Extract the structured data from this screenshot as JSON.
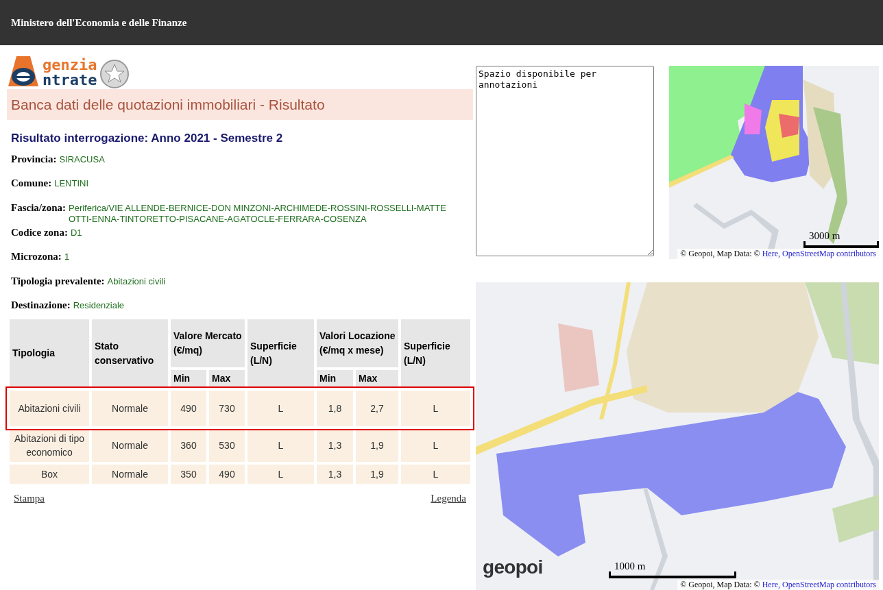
{
  "header": {
    "title": "Ministero dell'Economia e delle Finanze"
  },
  "logo": {
    "line_1": "genzia",
    "line_2": "ntrate"
  },
  "page_title": "Banca dati delle quotazioni immobiliari - Risultato",
  "result_heading": "Risultato interrogazione: Anno 2021 - Semestre 2",
  "fields": [
    {
      "label": "Provincia:",
      "value": "SIRACUSA"
    },
    {
      "label": "Comune:",
      "value": "LENTINI"
    },
    {
      "label": "Fascia/zona:",
      "value": "Periferica/VIE ALLENDE-BERNICE-DON MINZONI-ARCHIMEDE-ROSSINI-ROSSELLI-MATTEOTTI-ENNA-TINTORETTO-PISACANE-AGATOCLE-FERRARA-COSENZA"
    },
    {
      "label": "Codice zona:",
      "value": "D1"
    },
    {
      "label": "Microzona:",
      "value": "1"
    },
    {
      "label": "Tipologia prevalente:",
      "value": "Abitazioni civili"
    },
    {
      "label": "Destinazione:",
      "value": "Residenziale"
    }
  ],
  "table": {
    "columns": [
      {
        "label": "Tipologia"
      },
      {
        "label": "Stato conservativo"
      },
      {
        "label": "Valore Mercato (€/mq)",
        "colspan": 2,
        "subcolumns": [
          "Min",
          "Max"
        ]
      },
      {
        "label": "Superficie (L/N)"
      },
      {
        "label": "Valori Locazione (€/mq x mese)",
        "colspan": 2,
        "subcolumns": [
          "Min",
          "Max"
        ]
      },
      {
        "label": "Superficie (L/N)"
      }
    ],
    "rows": [
      {
        "selected": true,
        "cells": [
          "Abitazioni civili",
          "Normale",
          "490",
          "730",
          "L",
          "1,8",
          "2,7",
          "L"
        ]
      },
      {
        "selected": false,
        "cells": [
          "Abitazioni di tipo economico",
          "Normale",
          "360",
          "530",
          "L",
          "1,3",
          "1,9",
          "L"
        ]
      },
      {
        "selected": false,
        "cells": [
          "Box",
          "Normale",
          "350",
          "490",
          "L",
          "1,3",
          "1,9",
          "L"
        ]
      }
    ]
  },
  "links": [
    "Stampa",
    "Legenda"
  ],
  "notes": {
    "value": "Spazio disponibile per annotazioni"
  },
  "maps": [
    {
      "scale": "3000 m",
      "attribution": "© Geopoi, Map Data: ©",
      "attribution_links": [
        "Here,",
        "OpenStreetMap contributors"
      ]
    },
    {
      "logo": "geopoi",
      "scale": "1000 m",
      "attribution": "© Geopoi, Map Data: ©",
      "attribution_links": [
        "Here,",
        "OpenStreetMap contributors"
      ]
    }
  ]
}
